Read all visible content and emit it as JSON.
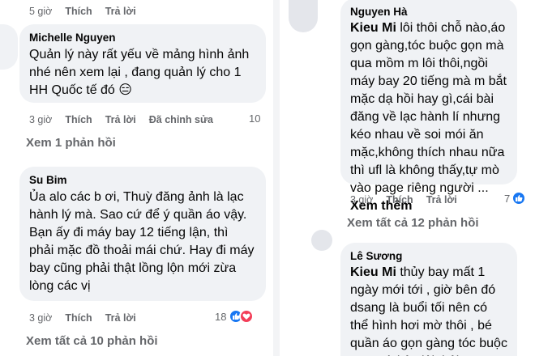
{
  "actions": {
    "like": "Thích",
    "reply": "Trả lời",
    "edited": "Đã chỉnh sửa"
  },
  "left": {
    "top_row": {
      "time": "5 giờ"
    },
    "comments": [
      {
        "author": "Michelle Nguyen",
        "text": "Quản lý này rất yếu về mảng hình ảnh nhé nên xem lại , đang quản lý cho 1 HH Quốc tế đó 😑",
        "time": "3 giờ",
        "reaction_count": "10",
        "view_replies": "Xem 1 phản hồi"
      },
      {
        "author": "Su Bim",
        "text": "Ủa alo các b ơi, Thuỳ đăng ảnh là lạc hành lý mà. Sao cứ để ý quần áo vậy. Bạn ấy đi máy bay 12 tiếng lận, thì phải mặc đồ thoải mái chứ. Hay đi máy bay cũng phải thật lồng lộn mới zừa lòng các vị",
        "time": "3 giờ",
        "reaction_count": "18",
        "view_replies": "Xem tất cả 10 phản hồi"
      }
    ]
  },
  "right": {
    "comments": [
      {
        "author": "Nguyen Hà",
        "tag": "Kieu Mi",
        "text": " lôi thôi chỗ nào,áo gọn gàng,tóc buộc gọn mà qua mồm m lôi thôi,ngồi máy bay 20 tiếng mà m bắt mặc dạ hồi hay gì,cái bài đăng về lạc hành lí nhưng kéo nhau về soi mói ăn mặc,không thích nhau nữa thì ufl là không thấy,tự mò vào page riêng người ...",
        "see_more": "Xem thêm",
        "time": "3 giờ",
        "reaction_count": "7",
        "view_replies": "Xem tất cả 12 phản hồi"
      },
      {
        "author": "Lê Sương",
        "tag": "Kieu Mi",
        "text": " thủy bay mất 1 ngày mới tới , giờ bên đó dsang là buổi tối nên có thể hình hơi mờ thôi , bé quần áo gọn gàng tóc buộc gọn mà kêu lôi thôi"
      }
    ]
  },
  "colors": {
    "bubble": "#f0f2f5",
    "secondary_text": "#65676b",
    "like": "#1877f2",
    "love": "#f33e58"
  }
}
